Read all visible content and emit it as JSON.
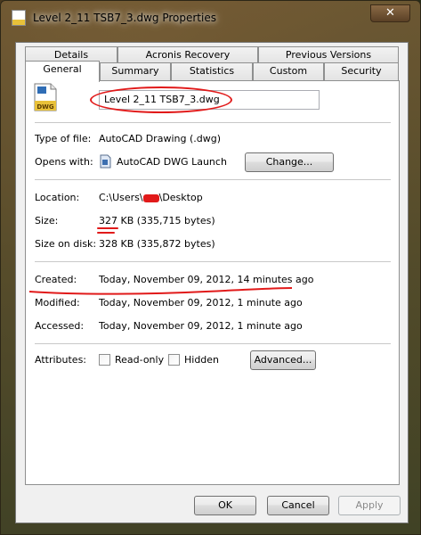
{
  "window": {
    "title": "Level 2_11 TSB7_3.dwg Properties",
    "close_glyph": "✕"
  },
  "tabs": {
    "row1": [
      {
        "label": "Details"
      },
      {
        "label": "Acronis Recovery"
      },
      {
        "label": "Previous Versions"
      }
    ],
    "row2": [
      {
        "label": "General"
      },
      {
        "label": "Summary"
      },
      {
        "label": "Statistics"
      },
      {
        "label": "Custom"
      },
      {
        "label": "Security"
      }
    ],
    "active": "General"
  },
  "general": {
    "file_icon": {
      "name": "dwg-file-icon",
      "badge": "DWG"
    },
    "filename": "Level 2_11 TSB7_3.dwg",
    "type_label": "Type of file:",
    "type_value": "AutoCAD Drawing (.dwg)",
    "opens_label": "Opens with:",
    "opens_value": "AutoCAD DWG Launch",
    "change_button": "Change...",
    "location_label": "Location:",
    "location_prefix": "C:\\Users\\",
    "location_suffix": "\\Desktop",
    "size_label": "Size:",
    "size_value": "327 KB (335,715 bytes)",
    "size_disk_label": "Size on disk:",
    "size_disk_value": "328 KB (335,872 bytes)",
    "created_label": "Created:",
    "created_value": "Today, November 09, 2012, 14 minutes ago",
    "modified_label": "Modified:",
    "modified_value": "Today, November 09, 2012, 1 minute ago",
    "accessed_label": "Accessed:",
    "accessed_value": "Today, November 09, 2012, 1 minute ago",
    "attributes_label": "Attributes:",
    "readonly_label": "Read-only",
    "hidden_label": "Hidden",
    "advanced_button": "Advanced..."
  },
  "buttons": {
    "ok": "OK",
    "cancel": "Cancel",
    "apply": "Apply"
  },
  "colors": {
    "annotation": "#e11a1a",
    "dialog_bg": "#f0f0f0",
    "content_bg": "#ffffff"
  }
}
